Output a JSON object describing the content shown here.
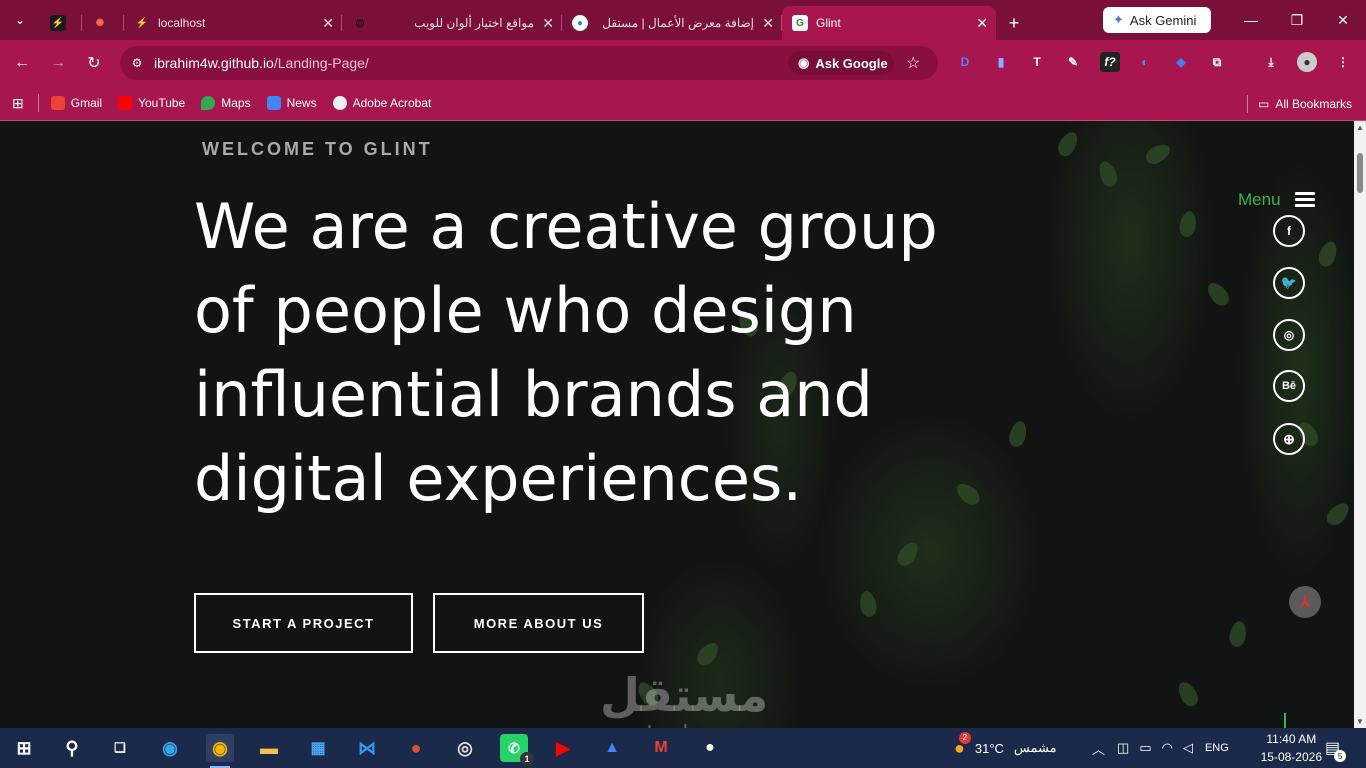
{
  "browser": {
    "tabs": [
      {
        "label": "",
        "fav_color": "#1a1a1a",
        "fav_glyph": "⚡"
      },
      {
        "label": "",
        "fav_color": "#7a0f3a",
        "fav_glyph": "✺"
      },
      {
        "label": "localhost",
        "fav_color": "#7a0f3a",
        "fav_glyph": "⚡"
      },
      {
        "label": "مواقع اختيار ألوان للويب",
        "fav_color": "#7a0f3a",
        "fav_glyph": "◎"
      },
      {
        "label": "إضافة معرض الأعمال | مستقل",
        "fav_color": "#2a8bd8",
        "fav_glyph": "●"
      },
      {
        "label": "Glint",
        "fav_color": "#ffffff",
        "fav_glyph": "G"
      }
    ],
    "new_tab": "+",
    "gemini": "Ask Gemini",
    "window": {
      "minimize": "—",
      "restore": "❐",
      "close": "✕"
    },
    "url_host": "ibrahim4w.github.io",
    "url_path": "/Landing-Page/",
    "ask_google": "Ask Google",
    "bookmarks": [
      {
        "label": "Gmail",
        "color": "#ea4335"
      },
      {
        "label": "YouTube",
        "color": "#ff0000"
      },
      {
        "label": "Maps",
        "color": "#34a853"
      },
      {
        "label": "News",
        "color": "#4285f4"
      },
      {
        "label": "Adobe Acrobat",
        "color": "#eeeeee"
      }
    ],
    "all_bookmarks": "All Bookmarks"
  },
  "page": {
    "welcome": "WELCOME TO GLINT",
    "headline_lines": [
      "We are a creative group",
      "of people who design",
      "influential brands and",
      "digital experiences."
    ],
    "btn_start": "START A PROJECT",
    "btn_more": "MORE ABOUT US",
    "menu_label": "Menu",
    "social": [
      {
        "name": "facebook",
        "glyph": "f"
      },
      {
        "name": "twitter",
        "glyph": "🐦"
      },
      {
        "name": "instagram",
        "glyph": "◎"
      },
      {
        "name": "behance",
        "glyph": "Bē"
      },
      {
        "name": "dribbble",
        "glyph": "⊕"
      }
    ],
    "accent_color": "#39b54a"
  },
  "watermark": {
    "arabic": "مستقل",
    "latin": "mostaql.com"
  },
  "taskbar": {
    "weather_temp": "31°C",
    "weather_label": "مشمس",
    "weather_badge": "2",
    "language": "ENG",
    "time": "11:40 AM",
    "date": "15-08-2026",
    "notifications": "5",
    "whatsapp_badge": "1"
  }
}
